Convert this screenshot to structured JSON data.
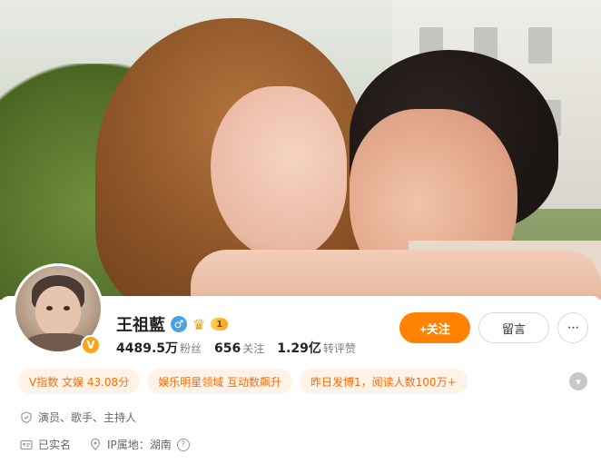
{
  "profile": {
    "name": "王祖藍",
    "level": "1",
    "badge_letter": "V",
    "stats": [
      {
        "value": "4489.5万",
        "label": "粉丝"
      },
      {
        "value": "656",
        "label": "关注"
      },
      {
        "value": "1.29亿",
        "label": "转评赞"
      }
    ]
  },
  "actions": {
    "follow_label": "+关注",
    "message_label": "留言",
    "more_label": "···"
  },
  "tags": [
    "V指数 文娱 43.08分",
    "娱乐明星领域 互动数飙升",
    "昨日发博1，阅读人数100万+"
  ],
  "info": {
    "occupation": "演员、歌手、主持人",
    "verification": "已实名",
    "ip_location": "IP属地：湖南"
  },
  "colors": {
    "accent": "#ff8200",
    "tag_bg": "#fff3e8",
    "tag_text": "#ff6a00",
    "gender": "#4fa0e0"
  },
  "icons": {
    "gender": "male-icon",
    "crown": "crown-icon",
    "occupation": "shield-icon",
    "verification": "id-card-icon",
    "ip": "location-icon",
    "help": "question-icon",
    "expand": "chevron-down-icon"
  }
}
